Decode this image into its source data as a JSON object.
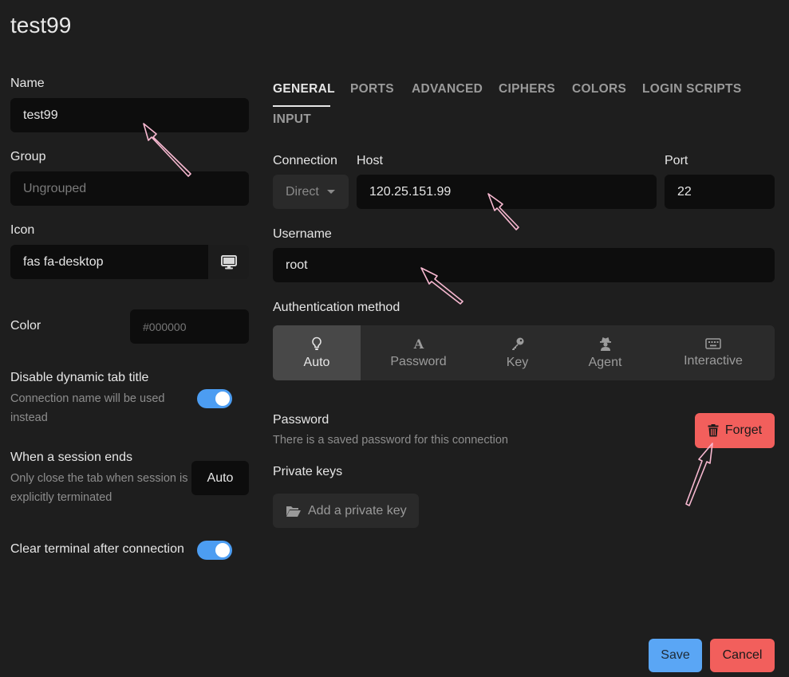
{
  "window": {
    "title": "test99"
  },
  "left": {
    "name": {
      "label": "Name",
      "value": "test99"
    },
    "group": {
      "label": "Group",
      "placeholder": "Ungrouped"
    },
    "icon": {
      "label": "Icon",
      "value": "fas fa-desktop"
    },
    "color": {
      "label": "Color",
      "placeholder": "#000000"
    },
    "dynamic_title": {
      "label": "Disable dynamic tab title",
      "description": "Connection name will be used instead",
      "enabled": true
    },
    "session_end": {
      "label": "When a session ends",
      "description": "Only close the tab when session is explicitly terminated",
      "value": "Auto"
    },
    "clear_terminal": {
      "label": "Clear terminal after connection",
      "enabled": true
    }
  },
  "tabs": [
    {
      "label": "GENERAL",
      "active": true
    },
    {
      "label": "PORTS"
    },
    {
      "label": "ADVANCED"
    },
    {
      "label": "CIPHERS"
    },
    {
      "label": "COLORS"
    },
    {
      "label": "LOGIN SCRIPTS"
    },
    {
      "label": "INPUT"
    }
  ],
  "general": {
    "connection": {
      "label": "Connection",
      "value": "Direct"
    },
    "host": {
      "label": "Host",
      "value": "120.25.151.99"
    },
    "port": {
      "label": "Port",
      "value": "22"
    },
    "username": {
      "label": "Username",
      "value": "root"
    },
    "auth": {
      "label": "Authentication method",
      "options": [
        {
          "label": "Auto",
          "icon": "lightbulb-icon",
          "active": true
        },
        {
          "label": "Password",
          "icon": "font-icon"
        },
        {
          "label": "Key",
          "icon": "key-icon"
        },
        {
          "label": "Agent",
          "icon": "user-secret-icon"
        },
        {
          "label": "Interactive",
          "icon": "keyboard-icon"
        }
      ]
    },
    "password": {
      "label": "Password",
      "description": "There is a saved password for this connection",
      "forget_label": "Forget"
    },
    "private_keys": {
      "label": "Private keys",
      "add_label": "Add a private key"
    }
  },
  "footer": {
    "save_label": "Save",
    "cancel_label": "Cancel"
  },
  "colors": {
    "accent": "#5aa6f5",
    "danger": "#f25f5c",
    "toggle": "#4c9df2",
    "annotation": "#f7b8d0"
  }
}
